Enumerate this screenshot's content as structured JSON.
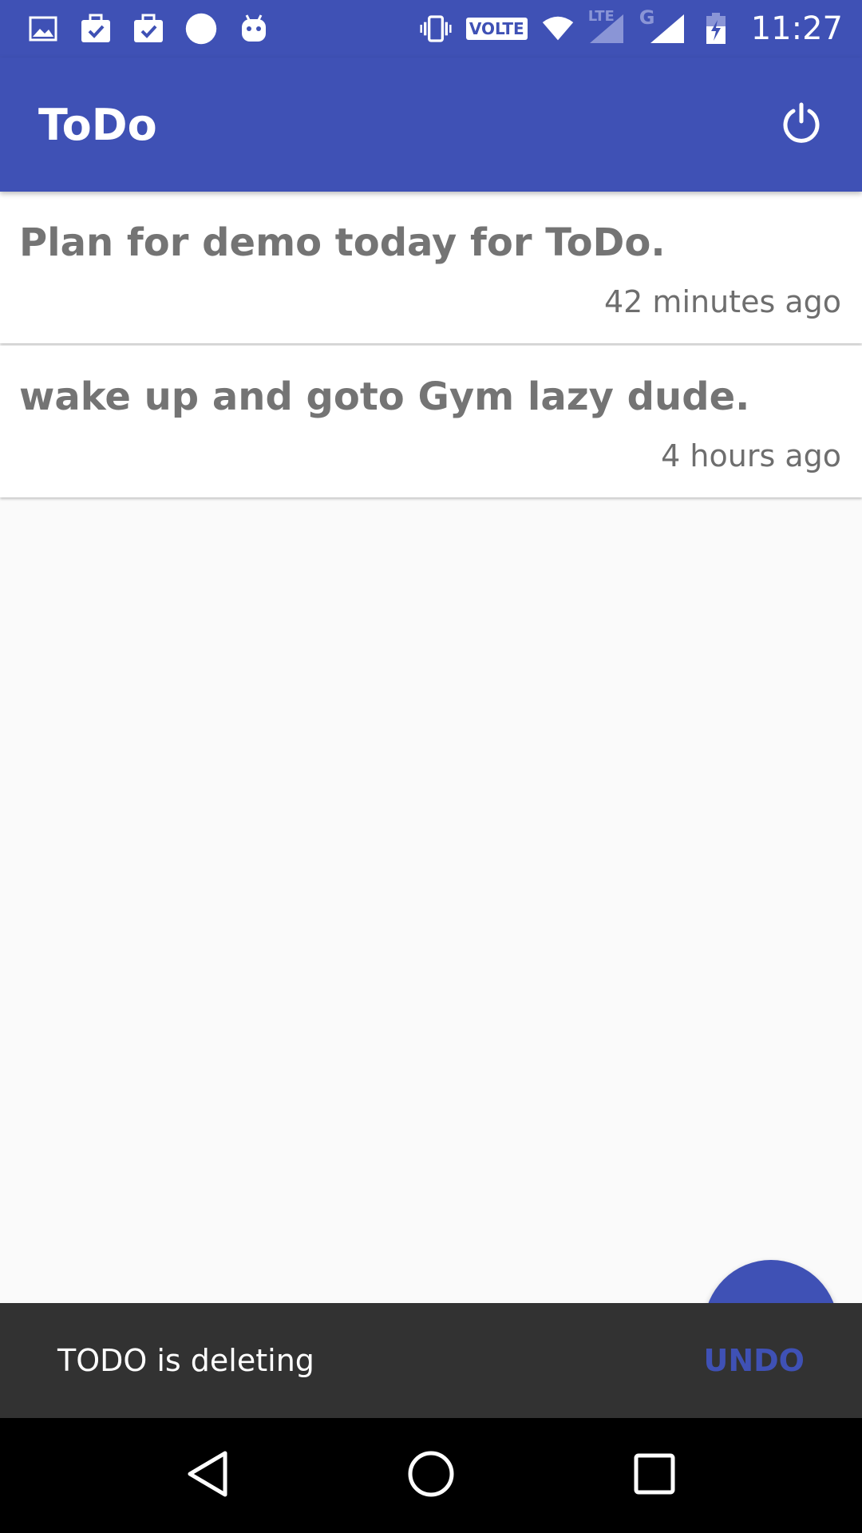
{
  "status_bar": {
    "time": "11:27",
    "volte_label": "VOLTE",
    "lte_label": "LTE",
    "g_label": "G",
    "left_icons": [
      "image-icon",
      "briefcase-check-icon",
      "briefcase-check-icon",
      "circle-icon",
      "android-icon"
    ],
    "right_icons": [
      "vibrate-icon",
      "volte-icon",
      "wifi-icon",
      "signal-lte-icon",
      "signal-g-icon",
      "battery-charging-icon"
    ]
  },
  "app_bar": {
    "title": "ToDo",
    "action_icon": "power-icon"
  },
  "todos": [
    {
      "text": "Plan for demo today for ToDo.",
      "time": "42 minutes ago"
    },
    {
      "text": "wake up and goto Gym lazy dude.",
      "time": "4 hours ago"
    }
  ],
  "snackbar": {
    "message": "TODO is deleting",
    "action": "UNDO"
  },
  "nav_bar": {
    "buttons": [
      "back-icon",
      "home-icon",
      "recents-icon"
    ]
  },
  "colors": {
    "primary": "#3f51b5",
    "snackbar_bg": "#323232",
    "background": "#fafafa"
  }
}
